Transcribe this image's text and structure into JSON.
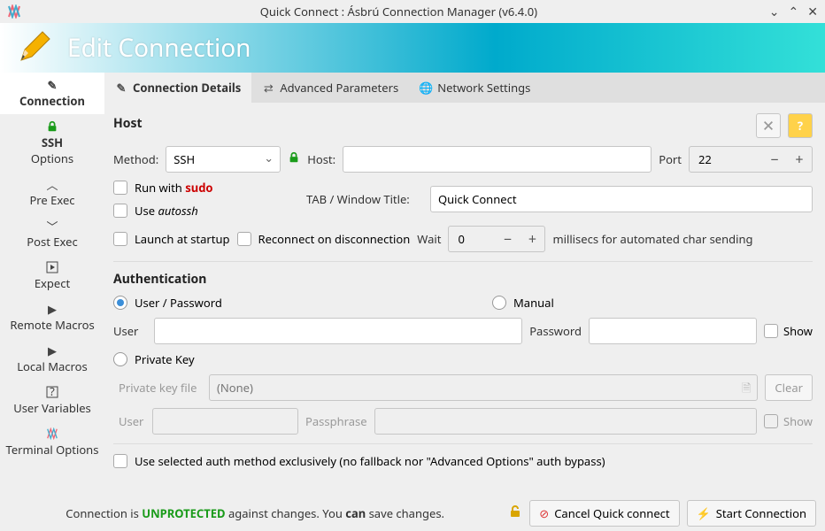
{
  "titlebar": {
    "title": "Quick Connect : Ásbrú Connection Manager (v6.4.0)"
  },
  "header": {
    "title": "Edit Connection"
  },
  "sidebar": {
    "items": [
      {
        "label": "Connection",
        "icon": "pencil-icon",
        "active": true
      },
      {
        "label1": "SSH",
        "label2": "Options",
        "icon": "lock-icon"
      },
      {
        "label": "Pre Exec",
        "icon": "chevron-up-icon"
      },
      {
        "label": "Post Exec",
        "icon": "chevron-down-icon"
      },
      {
        "label": "Expect",
        "icon": "play-box-icon"
      },
      {
        "label": "Remote Macros",
        "icon": "play-icon"
      },
      {
        "label": "Local Macros",
        "icon": "play-icon"
      },
      {
        "label": "User Variables",
        "icon": "question-box-icon"
      },
      {
        "label": "Terminal Options",
        "icon": "asbru-icon"
      }
    ]
  },
  "tabs": [
    {
      "label": "Connection Details",
      "icon": "pencil-icon",
      "active": true
    },
    {
      "label": "Advanced Parameters",
      "icon": "sliders-icon"
    },
    {
      "label": "Network Settings",
      "icon": "globe-icon"
    }
  ],
  "host_section": {
    "title": "Host",
    "method_label": "Method:",
    "method_value": "SSH",
    "host_label": "Host:",
    "host_value": "",
    "port_label": "Port",
    "port_value": "22",
    "run_with_label_pre": "Run with ",
    "run_with_sudo": "sudo",
    "use_autossh_pre": "Use ",
    "use_autossh_em": "autossh",
    "tab_title_label": "TAB / Window Title:",
    "tab_title_value": "Quick Connect",
    "launch_startup_label": "Launch at startup",
    "reconnect_label": "Reconnect on disconnection",
    "wait_label": "Wait",
    "wait_value": "0",
    "wait_suffix": "millisecs for automated char sending"
  },
  "auth_section": {
    "title": "Authentication",
    "user_password_label": "User / Password",
    "manual_label": "Manual",
    "user_label": "User",
    "user_value": "",
    "password_label": "Password",
    "password_value": "",
    "show_label": "Show",
    "private_key_label": "Private Key",
    "pk_file_label": "Private key file",
    "pk_file_placeholder": "(None)",
    "pk_user_label": "User",
    "pk_pass_label": "Passphrase",
    "pk_show_label": "Show",
    "clear_label": "Clear",
    "exclusive_label": "Use selected auth method exclusively (no fallback nor \"Advanced Options\" auth bypass)"
  },
  "footer": {
    "status_pre": "Connection is ",
    "status_unprotected": "UNPROTECTED",
    "status_mid": " against changes. You ",
    "status_can": "can",
    "status_post": " save changes.",
    "cancel_label": "Cancel Quick connect",
    "start_label": "Start Connection"
  }
}
